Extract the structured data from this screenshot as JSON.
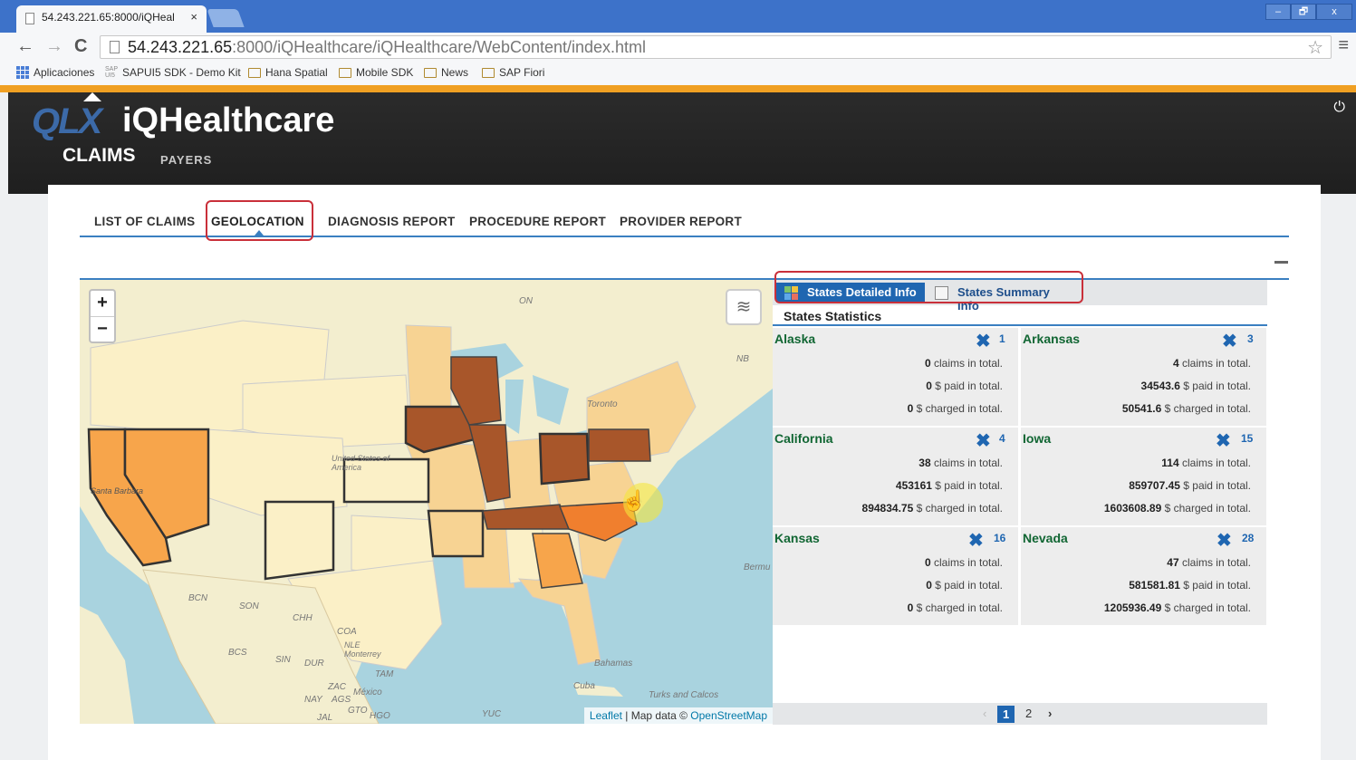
{
  "browser": {
    "tab_title": "54.243.221.65:8000/iQHeal",
    "tab_close": "×",
    "url_host": "54.243.221.65",
    "url_path": ":8000/iQHealthcare/iQHealthcare/WebContent/index.html",
    "back": "←",
    "forward": "→",
    "reload": "C",
    "star": "☆",
    "menu": "≡",
    "window_min": "–",
    "window_max": "🗗",
    "window_close": "x",
    "bookmarks": [
      "Aplicaciones",
      "SAPUI5 SDK - Demo Kit",
      "Hana Spatial",
      "Mobile SDK",
      "News",
      "SAP Fiori"
    ],
    "sap_mark": "SAP UI5"
  },
  "app": {
    "logo": "QLX",
    "brand": "iQHealthcare",
    "power": "⏻",
    "main_tabs": [
      "CLAIMS",
      "PAYERS"
    ],
    "sub_tabs": [
      "LIST OF CLAIMS",
      "GEOLOCATION",
      "DIAGNOSIS REPORT",
      "PROCEDURE REPORT",
      "PROVIDER REPORT"
    ],
    "minimize": "—"
  },
  "map": {
    "zoom_in": "+",
    "zoom_out": "−",
    "layers": "≋",
    "labels": [
      "ON",
      "NB",
      "Toronto",
      "Bermu",
      "Bahamas",
      "Cuba",
      "Turks and Calcos",
      "México",
      "BCN",
      "SON",
      "CHH",
      "COA",
      "NLE Monterrey",
      "TAM",
      "SIN",
      "DUR",
      "ZAC",
      "NAY",
      "AGS",
      "GTO",
      "HGO",
      "JAL",
      "YUC",
      "BCS",
      "United States of America",
      "Santa Barbara"
    ],
    "attribution_leaflet": "Leaflet",
    "attribution_text": " | Map data © ",
    "attribution_osm": "OpenStreetMap",
    "colors": {
      "water": "#a9d3df",
      "land": "#f3eecf",
      "light": "#fbf0c7",
      "mid": "#f7d393",
      "orange": "#f7a54b",
      "dark": "#a8562a",
      "darker": "#7c3d1c"
    }
  },
  "stats": {
    "tab_detailed": "States Detailed Info",
    "tab_summary": "States Summary Info",
    "title": "States Statistics",
    "x_glyph": "✖",
    "states": [
      {
        "name": "Alaska",
        "id": "1",
        "claims": "0",
        "paid": "0",
        "charged": "0"
      },
      {
        "name": "Arkansas",
        "id": "3",
        "claims": "4",
        "paid": "34543.6",
        "charged": "50541.6"
      },
      {
        "name": "California",
        "id": "4",
        "claims": "38",
        "paid": "453161",
        "charged": "894834.75"
      },
      {
        "name": "Iowa",
        "id": "15",
        "claims": "114",
        "paid": "859707.45",
        "charged": "1603608.89"
      },
      {
        "name": "Kansas",
        "id": "16",
        "claims": "0",
        "paid": "0",
        "charged": "0"
      },
      {
        "name": "Nevada",
        "id": "28",
        "claims": "47",
        "paid": "581581.81",
        "charged": "1205936.49"
      }
    ],
    "claims_suffix": " claims in total.",
    "paid_suffix": " $ paid in total.",
    "charged_suffix": " $ charged in total.",
    "pager": {
      "prev": "‹",
      "pages": [
        "1",
        "2"
      ],
      "next": "›"
    }
  }
}
